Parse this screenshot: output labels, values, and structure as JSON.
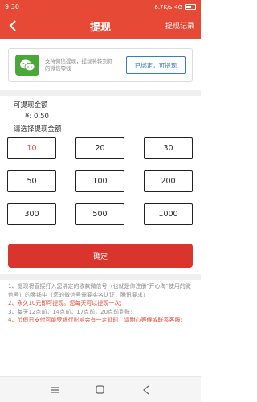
{
  "status_bar": {
    "time": "9:30",
    "network": "8.7K/s",
    "signal": "4G",
    "battery_icon": "battery-icon"
  },
  "header": {
    "title": "提现",
    "right_link": "提现记录",
    "back_icon": "chevron-left-icon"
  },
  "wechat": {
    "icon": "wechat-icon",
    "description": "支持微信提现，提现将转到你的微信零钱",
    "bind_button": "已绑定，可提现"
  },
  "balance": {
    "label": "可提现金额",
    "value": "¥: 0.50",
    "choose_label": "请选择提现金额"
  },
  "amounts": [
    "10",
    "20",
    "30",
    "50",
    "100",
    "200",
    "300",
    "500",
    "1000"
  ],
  "selected_amount": "10",
  "confirm_button": "确定",
  "notes": [
    {
      "text": "1、提现将直接打入您绑定的收款微信号（也就是你注册\"开心淘\"使用的微信号）的零钱中（您的微信号需要实名认证，腾讯要求）",
      "style": "gray"
    },
    {
      "text": "2、永久10元即可提现。您每天可以提现一次;",
      "style": "red"
    },
    {
      "text": "3、每天12点前，14点前，17点前，20点前到账;",
      "style": "gray"
    },
    {
      "text": "4、节假日支付可能受银行影响会有一定延时，请耐心等候或联系客服;",
      "style": "red"
    }
  ],
  "system_nav": {
    "menu_icon": "menu-icon",
    "home_icon": "home-icon",
    "back_icon": "back-triangle-icon"
  },
  "colors": {
    "primary": "#e64a36",
    "wechat_green": "#4aa83a",
    "link_blue": "#3a78c8"
  }
}
